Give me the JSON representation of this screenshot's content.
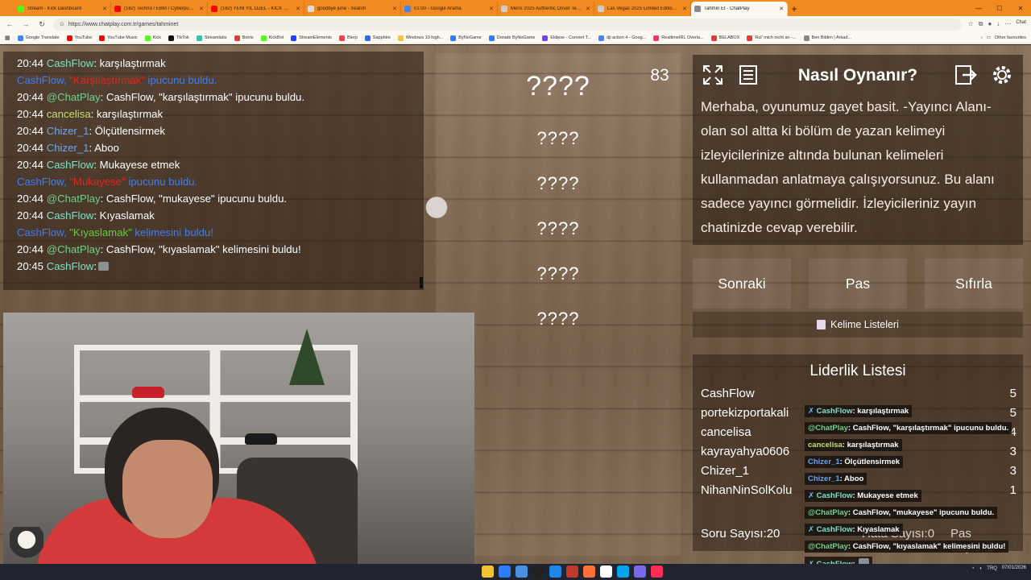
{
  "browser": {
    "tabs": [
      {
        "label": "Stream - Kick Dashboard",
        "color": "#53fc18",
        "active": false
      },
      {
        "label": "(162) Techno / EBM / Cyberpunk / ...",
        "color": "#ff0000",
        "active": false
      },
      {
        "label": "(162) YENİ YIL ÖZEL - KICK WRAP...",
        "color": "#ff0000",
        "active": false
      },
      {
        "label": "goodbye june - Search",
        "color": "#dddddd",
        "active": false
      },
      {
        "label": "01:00 - Google Arama",
        "color": "#4285f4",
        "active": false
      },
      {
        "label": "Mens 2025 Authentic Driver Tee Y...",
        "color": "#cccccc",
        "active": false
      },
      {
        "label": "Las Vegas 2025 Limited Edition T...",
        "color": "#cccccc",
        "active": false
      },
      {
        "label": "Tahmin Et - ChatPlay",
        "color": "#888888",
        "active": true
      }
    ],
    "url": "https://www.chatplay.com.tr/games/tahminet",
    "chat_button": "Chat",
    "bookmarks": [
      {
        "label": "Google Translate",
        "color": "#4285f4"
      },
      {
        "label": "YouTube",
        "color": "#ff0000"
      },
      {
        "label": "YouTube Music",
        "color": "#ff0000"
      },
      {
        "label": "Kick",
        "color": "#53fc18"
      },
      {
        "label": "TikTok",
        "color": "#111111"
      },
      {
        "label": "Streamlabs",
        "color": "#31c3a2"
      },
      {
        "label": "Botrix",
        "color": "#e53935"
      },
      {
        "label": "KickBot",
        "color": "#53fc18"
      },
      {
        "label": "StreamElements",
        "color": "#1e40ff"
      },
      {
        "label": "Blerp",
        "color": "#ff3b4a"
      },
      {
        "label": "Sapphire",
        "color": "#2a6df4"
      },
      {
        "label": "Windows 10 high...",
        "color": "#f6c343"
      },
      {
        "label": "ByNoGame",
        "color": "#2b7cff"
      },
      {
        "label": "Donate ByNoGame",
        "color": "#2b7cff"
      },
      {
        "label": "Eklipse - Convert T...",
        "color": "#7b3ff2"
      },
      {
        "label": "dji action 4 - Goog...",
        "color": "#4285f4"
      },
      {
        "label": "RealtimeIRL Overla...",
        "color": "#ff3366"
      },
      {
        "label": "BELABOX",
        "color": "#e53935"
      },
      {
        "label": "Rul' mich nicht an -...",
        "color": "#e53935"
      },
      {
        "label": "Ben Bildim | Arkad...",
        "color": "#888888"
      }
    ],
    "other_favourites": "Other favourites"
  },
  "chat": {
    "lines": [
      {
        "time": "20:44",
        "user": "CashFlow",
        "user_class": "n-cashflow",
        "text": ": karşılaştırmak"
      },
      {
        "system": true,
        "user": "CashFlow, ",
        "hint": "\"Karşılaştırmak\"",
        "rest": " ipucunu buldu.",
        "kind": "hint"
      },
      {
        "time": "20:44",
        "user": "@ChatPlay",
        "user_class": "n-chatplay",
        "text": ": CashFlow, \"karşılaştırmak\" ipucunu buldu."
      },
      {
        "time": "20:44",
        "user": "cancelisa",
        "user_class": "n-cancelisa",
        "text": ": karşılaştırmak"
      },
      {
        "time": "20:44",
        "user": "Chizer_1",
        "user_class": "n-chizer",
        "text": ": Ölçütlensirmek"
      },
      {
        "time": "20:44",
        "user": "Chizer_1",
        "user_class": "n-chizer",
        "text": ": Aboo"
      },
      {
        "time": "20:44",
        "user": "CashFlow",
        "user_class": "n-cashflow",
        "text": ": Mukayese etmek"
      },
      {
        "system": true,
        "user": "CashFlow, ",
        "hint": "\"Mukayese\"",
        "rest": " ipucunu buldu.",
        "kind": "hint"
      },
      {
        "time": "20:44",
        "user": "@ChatPlay",
        "user_class": "n-chatplay",
        "text": ": CashFlow, \"mukayese\" ipucunu buldu."
      },
      {
        "time": "20:44",
        "user": "CashFlow",
        "user_class": "n-cashflow",
        "text": ": Kıyaslamak"
      },
      {
        "system": true,
        "user": "CashFlow, ",
        "hint": "\"Kıyaslamak\"",
        "rest": " kelimesini buldu!",
        "kind": "found"
      },
      {
        "time": "20:44",
        "user": "@ChatPlay",
        "user_class": "n-chatplay",
        "text": ": CashFlow, \"kıyaslamak\" kelimesini buldu!"
      },
      {
        "time": "20:45",
        "user": "CashFlow",
        "user_class": "n-cashflow",
        "text": ":",
        "emote": true
      }
    ]
  },
  "game": {
    "counter": "83",
    "words": [
      "????",
      "????",
      "????",
      "????",
      "????",
      "????"
    ]
  },
  "how": {
    "title": "Nasıl Oynanır?",
    "text": "Merhaba, oyunumuz gayet basit. -Yayıncı Alanı- olan sol altta ki bölüm de yazan kelimeyi izleyicilerinize altında bulunan kelimeleri kullanmadan anlatmaya çalışıyorsunuz. Bu alanı sadece yayıncı görmelidir. İzleyicileriniz yayın chatinizde cevap verebilir."
  },
  "buttons": {
    "next": "Sonraki",
    "pass": "Pas",
    "reset": "Sıfırla",
    "word_lists": "Kelime Listeleri"
  },
  "leaderboard": {
    "title": "Liderlik Listesi",
    "rows": [
      {
        "name": "CashFlow",
        "score": "5"
      },
      {
        "name": "portekizportakali",
        "score": "5"
      },
      {
        "name": "cancelisa",
        "score": "4"
      },
      {
        "name": "kayrayahya0606",
        "score": "3"
      },
      {
        "name": "Chizer_1",
        "score": "3"
      },
      {
        "name": "NihanNinSolKolu",
        "score": "1"
      }
    ],
    "questions": "Soru Sayısı:20",
    "errors": "Hata Sayısı:0",
    "passes": "Pas Sayısı:2"
  },
  "overlay_chat": [
    {
      "icon": true,
      "user": "CashFlow",
      "cls": "on-cash",
      "text": ": karşılaştırmak"
    },
    {
      "icon": false,
      "user": "@ChatPlay",
      "cls": "on-chat",
      "text": ": CashFlow, \"karşılaştırmak\" ipucunu buldu."
    },
    {
      "icon": false,
      "user": "cancelisa",
      "cls": "on-cancel",
      "text": ": karşılaştırmak"
    },
    {
      "icon": false,
      "user": "Chizer_1",
      "cls": "on-chizer",
      "text": ": Ölçütlensirmek"
    },
    {
      "icon": false,
      "user": "Chizer_1",
      "cls": "on-chizer",
      "text": ": Aboo"
    },
    {
      "icon": true,
      "user": "CashFlow",
      "cls": "on-cash",
      "text": ": Mukayese etmek"
    },
    {
      "icon": false,
      "user": "@ChatPlay",
      "cls": "on-chat",
      "text": ": CashFlow, \"mukayese\" ipucunu buldu."
    },
    {
      "icon": true,
      "user": "CashFlow",
      "cls": "on-cash",
      "text": ": Kıyaslamak"
    },
    {
      "icon": false,
      "user": "@ChatPlay",
      "cls": "on-chat",
      "text": ": CashFlow, \"kıyaslamak\" kelimesini buldu!"
    },
    {
      "icon": true,
      "user": "CashFlow",
      "cls": "on-cash",
      "text": ": ",
      "emote": true
    }
  ],
  "taskbar": {
    "icon_colors": [
      "#f2c230",
      "#2b7cff",
      "#4a90e2",
      "#222222",
      "#1e88e5",
      "#c03a2b",
      "#ff7139",
      "#ffffff",
      "#00a4ef",
      "#7b68ee",
      "#ff2d55"
    ],
    "lang": "TRQ",
    "time": "",
    "date": "07/01/2026"
  }
}
